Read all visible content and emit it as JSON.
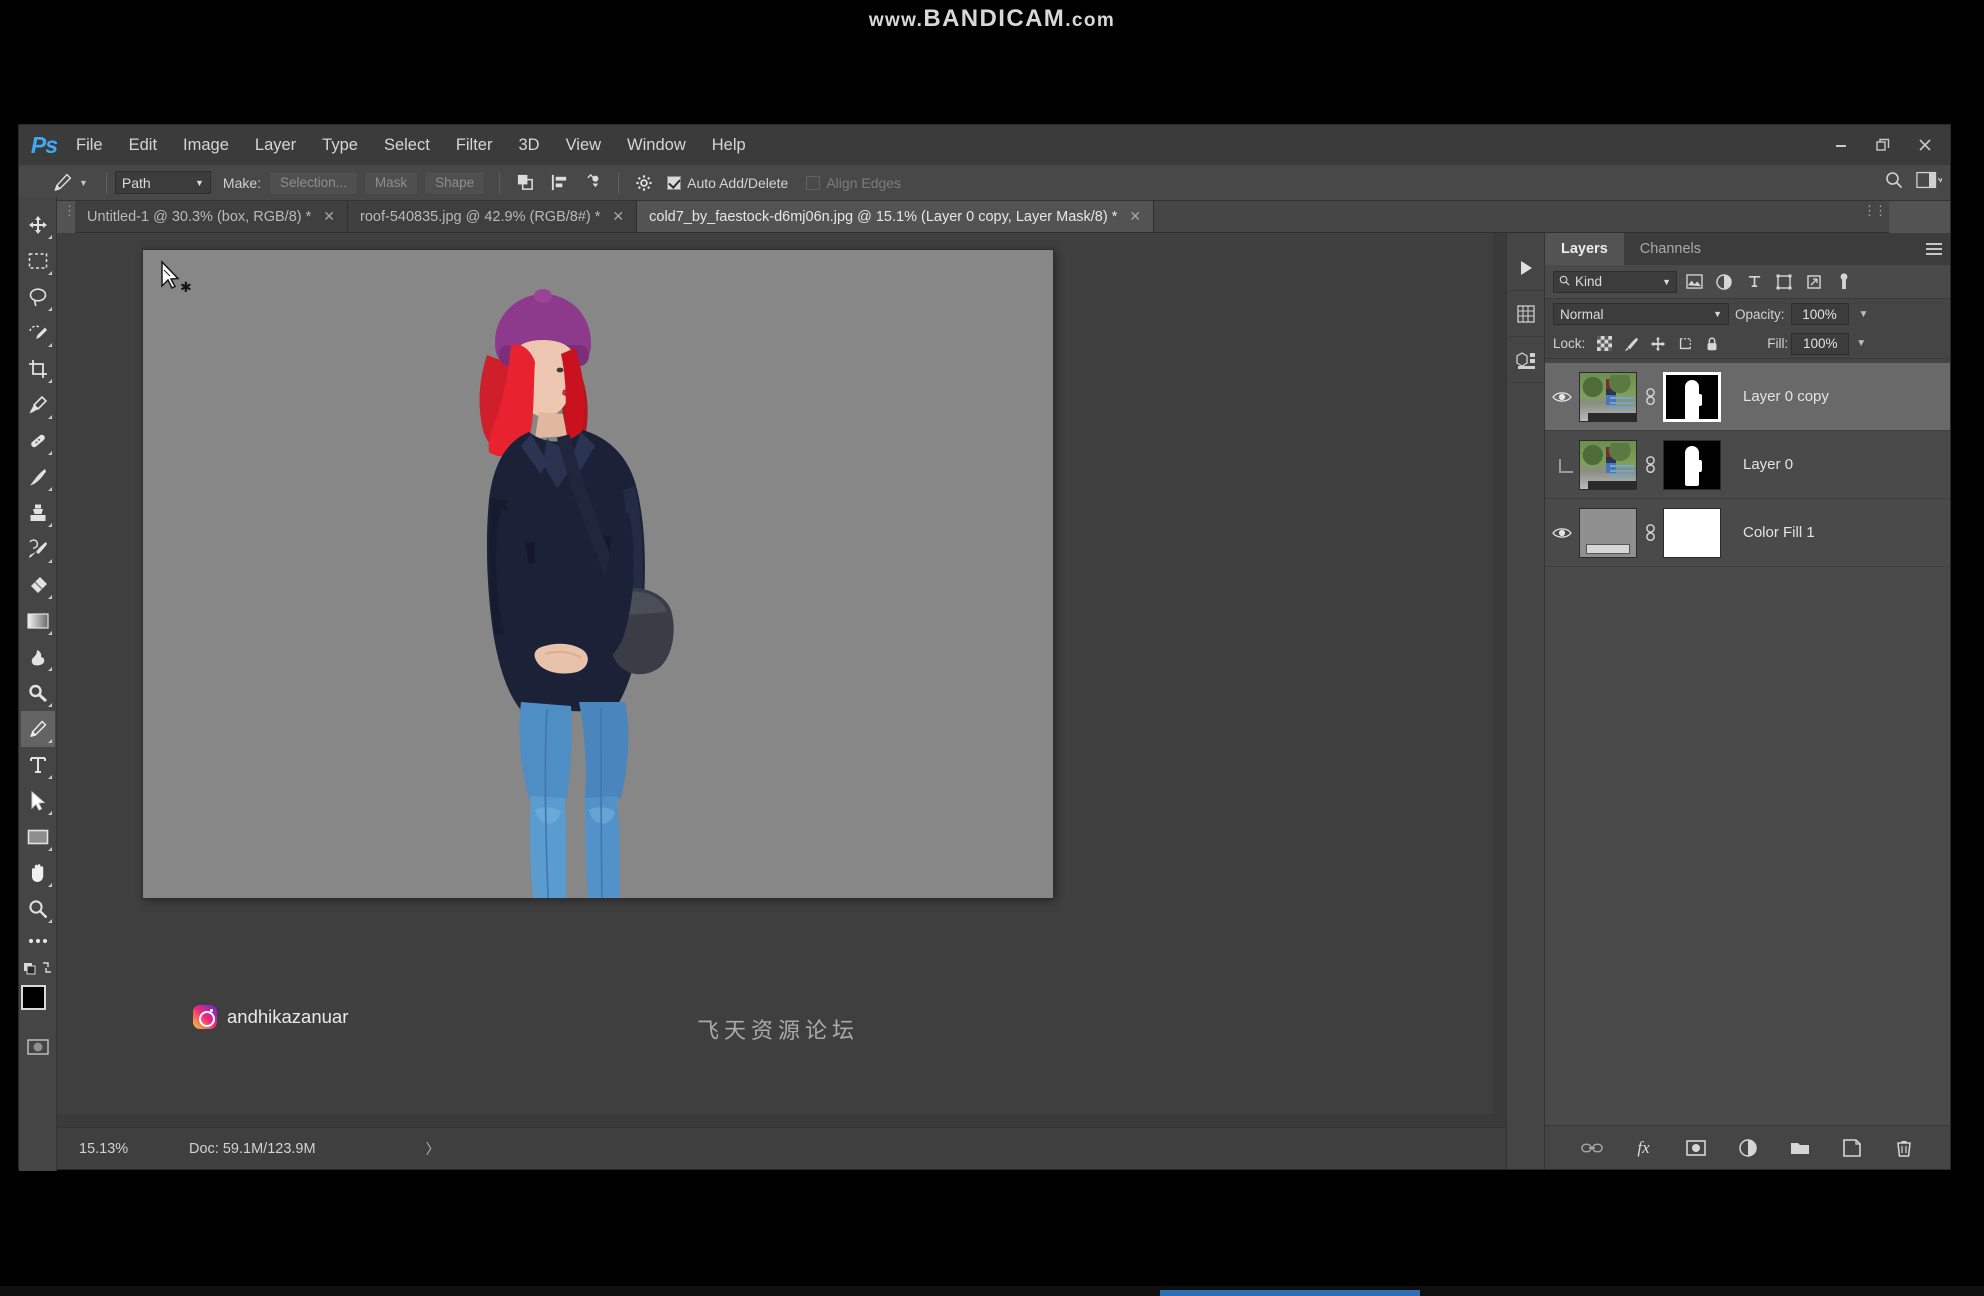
{
  "recorder_watermark": {
    "prefix": "www.",
    "brand": "BANDICAM",
    "suffix": ".com"
  },
  "app": {
    "logo": "Ps",
    "name": "Adobe Photoshop"
  },
  "menubar": {
    "items": [
      {
        "label": "File",
        "name": "menu-file"
      },
      {
        "label": "Edit",
        "name": "menu-edit"
      },
      {
        "label": "Image",
        "name": "menu-image"
      },
      {
        "label": "Layer",
        "name": "menu-layer"
      },
      {
        "label": "Type",
        "name": "menu-type"
      },
      {
        "label": "Select",
        "name": "menu-select"
      },
      {
        "label": "Filter",
        "name": "menu-filter"
      },
      {
        "label": "3D",
        "name": "menu-3d"
      },
      {
        "label": "View",
        "name": "menu-view"
      },
      {
        "label": "Window",
        "name": "menu-window"
      },
      {
        "label": "Help",
        "name": "menu-help"
      }
    ],
    "window_controls": {
      "minimize": "–",
      "restore": "❐",
      "close": "✕"
    }
  },
  "options_bar": {
    "tool_icon": "pen-tool-icon",
    "mode_value": "Path",
    "make_label": "Make:",
    "make_buttons": [
      {
        "label": "Selection...",
        "name": "make-selection-button"
      },
      {
        "label": "Mask",
        "name": "make-mask-button"
      },
      {
        "label": "Shape",
        "name": "make-shape-button"
      }
    ],
    "path_operations_icon": "path-operations-icon",
    "path_alignment_icon": "path-alignment-icon",
    "path_arrangement_icon": "path-arrangement-icon",
    "geometry_gear_icon": "gear-icon",
    "auto_add_delete": {
      "label": "Auto Add/Delete",
      "checked": true
    },
    "align_edges": {
      "label": "Align Edges",
      "checked": false,
      "disabled": true
    },
    "search_icon": "search-icon",
    "workspace_icon": "workspace-switcher-icon"
  },
  "document_tabs": [
    {
      "label": "Untitled-1 @ 30.3% (box, RGB/8) *",
      "active": false,
      "close": "✕"
    },
    {
      "label": "roof-540835.jpg @ 42.9% (RGB/8#) *",
      "active": false,
      "close": "✕"
    },
    {
      "label": "cold7_by_faestock-d6mj06n.jpg @ 15.1% (Layer 0 copy, Layer Mask/8) *",
      "active": true,
      "close": "✕"
    }
  ],
  "toolbar": {
    "tools": [
      {
        "name": "move-tool",
        "icon": "move-icon",
        "active": false
      },
      {
        "name": "rectangular-marquee-tool",
        "icon": "marquee-icon",
        "active": false
      },
      {
        "name": "lasso-tool",
        "icon": "lasso-icon",
        "active": false
      },
      {
        "name": "quick-selection-tool",
        "icon": "quick-selection-icon",
        "active": false
      },
      {
        "name": "crop-tool",
        "icon": "crop-icon",
        "active": false
      },
      {
        "name": "eyedropper-tool",
        "icon": "eyedropper-icon",
        "active": false
      },
      {
        "name": "spot-healing-brush-tool",
        "icon": "healing-brush-icon",
        "active": false
      },
      {
        "name": "brush-tool",
        "icon": "brush-icon",
        "active": false
      },
      {
        "name": "clone-stamp-tool",
        "icon": "stamp-icon",
        "active": false
      },
      {
        "name": "history-brush-tool",
        "icon": "history-brush-icon",
        "active": false
      },
      {
        "name": "eraser-tool",
        "icon": "eraser-icon",
        "active": false
      },
      {
        "name": "gradient-tool",
        "icon": "gradient-icon",
        "active": false
      },
      {
        "name": "blur-tool",
        "icon": "smudge-icon",
        "active": false
      },
      {
        "name": "dodge-tool",
        "icon": "dodge-icon",
        "active": false
      },
      {
        "name": "pen-tool",
        "icon": "pen-icon",
        "active": true
      },
      {
        "name": "horizontal-type-tool",
        "icon": "type-icon",
        "active": false
      },
      {
        "name": "path-selection-tool",
        "icon": "path-selection-icon",
        "active": false
      },
      {
        "name": "rectangle-tool",
        "icon": "rectangle-shape-icon",
        "active": false
      },
      {
        "name": "hand-tool",
        "icon": "hand-icon",
        "active": false
      },
      {
        "name": "zoom-tool",
        "icon": "magnifier-icon",
        "active": false
      },
      {
        "name": "edit-toolbar-button",
        "icon": "ellipsis-icon",
        "active": false
      }
    ],
    "color_swatches": {
      "foreground": "#000000",
      "background": "#ffffff",
      "default_colors_icon": "default-colors-icon",
      "swap_colors_icon": "swap-colors-icon"
    },
    "quick_mask_icon": "quick-mask-icon"
  },
  "canvas": {
    "background_color": "#878787",
    "cursor": "pen-tool-cursor-start-path",
    "instagram_watermark": "andhikazanuar",
    "forum_watermark": "飞天资源论坛",
    "subject_alt": "seated woman with purple beanie and red hair on grey background"
  },
  "status_bar": {
    "zoom": "15.13%",
    "doc_label": "Doc:",
    "doc_size": "59.1M/123.9M",
    "expand_arrow": "〉"
  },
  "dock_rail": {
    "buttons": [
      {
        "name": "expand-panels-button",
        "icon": "play-arrow-icon"
      },
      {
        "name": "libraries-panel-button",
        "icon": "grid-icon"
      },
      {
        "name": "properties-panel-button",
        "icon": "properties-icon"
      }
    ]
  },
  "layers_panel": {
    "tabs": [
      {
        "label": "Layers",
        "active": true
      },
      {
        "label": "Channels",
        "active": false
      }
    ],
    "panel_menu_icon": "hamburger-icon",
    "filter": {
      "search_icon": "search-icon",
      "kind_value": "Kind",
      "icons": [
        {
          "name": "filter-pixel-layers-icon"
        },
        {
          "name": "filter-adjustment-layers-icon"
        },
        {
          "name": "filter-type-layers-icon"
        },
        {
          "name": "filter-shape-layers-icon"
        },
        {
          "name": "filter-smart-object-icon"
        },
        {
          "name": "filter-toggle-icon"
        }
      ]
    },
    "blend_mode": "Normal",
    "opacity_label": "Opacity:",
    "opacity_value": "100%",
    "lock_label": "Lock:",
    "lock_icons": [
      {
        "name": "lock-transparent-pixels-icon"
      },
      {
        "name": "lock-image-pixels-icon"
      },
      {
        "name": "lock-position-icon"
      },
      {
        "name": "lock-artboard-icon"
      },
      {
        "name": "lock-all-icon"
      }
    ],
    "fill_label": "Fill:",
    "fill_value": "100%",
    "layers": [
      {
        "name": "Layer 0 copy",
        "visible": true,
        "selected": true,
        "thumb_type": "photo",
        "mask_type": "layer-mask",
        "mask_selected": true,
        "linked": true
      },
      {
        "name": "Layer 0",
        "visible": false,
        "selected": false,
        "thumb_type": "photo",
        "mask_type": "layer-mask",
        "mask_selected": false,
        "linked": true,
        "clipped": true
      },
      {
        "name": "Color Fill 1",
        "visible": true,
        "selected": false,
        "thumb_type": "solid-color",
        "mask_type": "white-mask",
        "mask_selected": false,
        "linked": true
      }
    ],
    "footer_buttons": [
      {
        "name": "link-layers-button",
        "icon": "link-icon"
      },
      {
        "name": "layer-style-button",
        "icon": "fx-icon",
        "label": "fx"
      },
      {
        "name": "add-layer-mask-button",
        "icon": "mask-icon"
      },
      {
        "name": "new-adjustment-layer-button",
        "icon": "half-circle-icon"
      },
      {
        "name": "new-group-button",
        "icon": "folder-icon"
      },
      {
        "name": "new-layer-button",
        "icon": "new-layer-icon"
      },
      {
        "name": "delete-layer-button",
        "icon": "trash-icon"
      }
    ]
  }
}
